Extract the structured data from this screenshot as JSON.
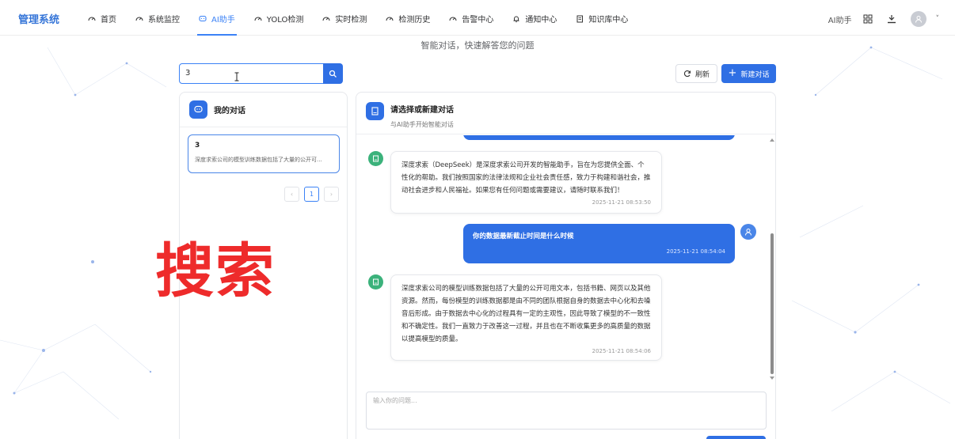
{
  "brand": "管理系统",
  "nav": [
    {
      "label": "首页",
      "icon": "dashboard-icon",
      "active": false
    },
    {
      "label": "系统监控",
      "icon": "dashboard-icon",
      "active": false
    },
    {
      "label": "AI助手",
      "icon": "chat-icon",
      "active": true
    },
    {
      "label": "YOLO检测",
      "icon": "dashboard-icon",
      "active": false
    },
    {
      "label": "实时检测",
      "icon": "dashboard-icon",
      "active": false
    },
    {
      "label": "检测历史",
      "icon": "dashboard-icon",
      "active": false
    },
    {
      "label": "告警中心",
      "icon": "dashboard-icon",
      "active": false
    },
    {
      "label": "通知中心",
      "icon": "bell-icon",
      "active": false
    },
    {
      "label": "知识库中心",
      "icon": "book-icon",
      "active": false
    }
  ],
  "top_right": {
    "label": "AI助手",
    "icons": [
      "grid-icon",
      "download-icon"
    ],
    "avatar_icon": "user-icon",
    "caret": "˅"
  },
  "subtitle": "智能对话，快速解答您的问题",
  "search": {
    "value": "3",
    "button_icon": "search-icon"
  },
  "actions": {
    "refresh_label": "刷新",
    "new_label": "新建对话",
    "new_plus": "+"
  },
  "left_panel": {
    "title": "我的对话",
    "conversations": [
      {
        "title": "3",
        "preview": "深度求索公司的模型训练数据包括了大量的公开可..."
      }
    ],
    "pager": {
      "prev": "‹",
      "current": "1",
      "next": "›"
    }
  },
  "right_panel": {
    "title": "请选择或新建对话",
    "subtitle": "与AI助手开始智能对话",
    "messages": [
      {
        "role": "assistant",
        "text": "深度求索（DeepSeek）是深度求索公司开发的智能助手，旨在为您提供全面、个性化的帮助。我们按照国家的法律法规和企业社会责任感，致力于构建和谐社会，推动社会进步和人民福祉。如果您有任何问题或需要建议，请随时联系我们！",
        "time": "2025-11-21 08:53:50"
      },
      {
        "role": "user",
        "text": "你的数据最新截止时间是什么时候",
        "time": "2025-11-21 08:54:04"
      },
      {
        "role": "assistant",
        "text": "深度求索公司的模型训练数据包括了大量的公开可用文本，包括书籍、网页以及其他资源。然而，每份模型的训练数据都是由不同的团队根据自身的数据去中心化和去噪音后形成。由于数据去中心化的过程具有一定的主观性，因此导致了模型的不一致性和不确定性。我们一直致力于改善这一过程，并且也在不断收集更多的高质量的数据以提高模型的质量。",
        "time": "2025-11-21 08:54:06"
      }
    ],
    "input_placeholder": "输入你的问题..."
  },
  "overlay_text": "搜索",
  "colors": {
    "primary": "#2f6fe4",
    "accent_red": "#ee2b2b",
    "bot_avatar": "#3bb27b"
  }
}
